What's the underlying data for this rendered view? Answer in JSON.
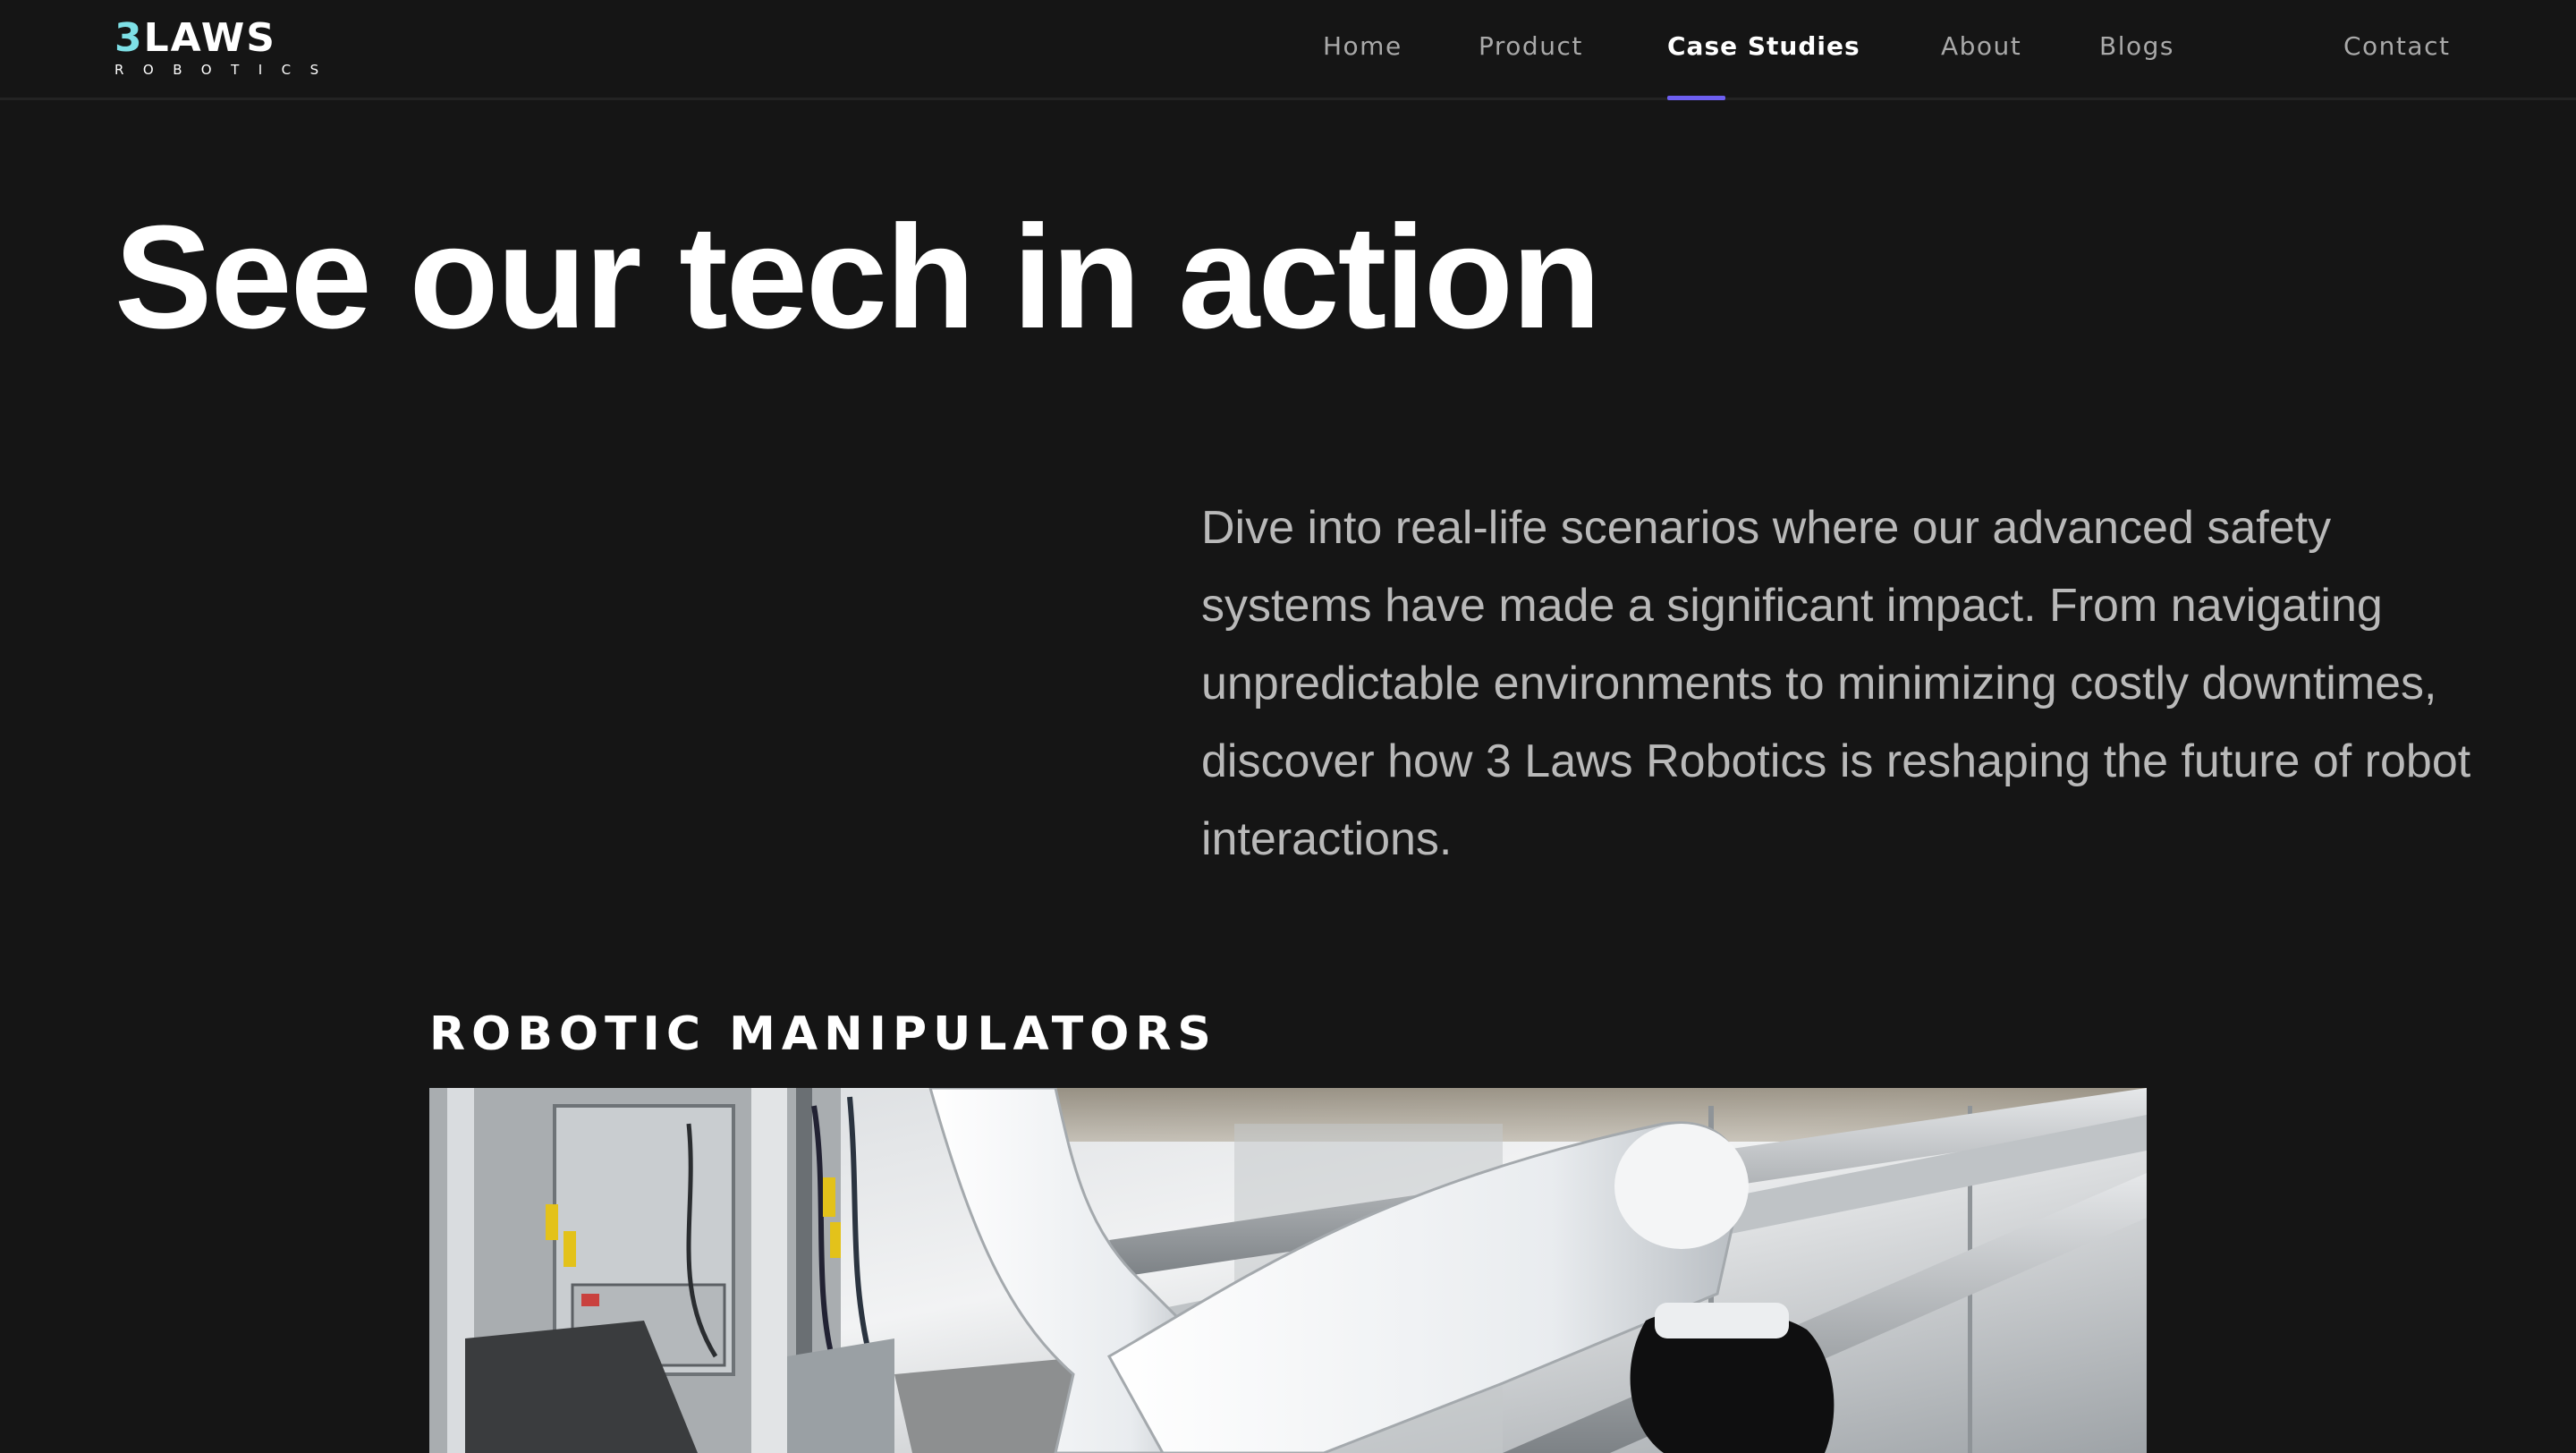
{
  "brand": {
    "logo_main_accent": "3",
    "logo_main_rest": "LAWS",
    "logo_sub": "ROBOTICS",
    "accent_color": "#7ee0e6"
  },
  "nav": {
    "items": [
      {
        "label": "Home",
        "active": false
      },
      {
        "label": "Product",
        "active": false
      },
      {
        "label": "Case Studies",
        "active": true
      },
      {
        "label": "About",
        "active": false
      },
      {
        "label": "Blogs",
        "active": false
      }
    ],
    "contact_label": "Contact",
    "active_indicator_color": "#6d5ff0"
  },
  "hero": {
    "title": "See our tech in action",
    "intro": "Dive into real-life scenarios where our advanced safety systems have made a significant impact. From navigating unpredictable environments to minimizing costly downtimes, discover how 3 Laws Robotics is reshaping the future of robot interactions."
  },
  "section": {
    "title": "ROBOTIC MANIPULATORS",
    "media_subject": "robot-arm-photo"
  },
  "colors": {
    "background": "#151515",
    "text_primary": "#ffffff",
    "text_muted": "#b9b9b9",
    "nav_inactive": "#a9a9a9"
  }
}
